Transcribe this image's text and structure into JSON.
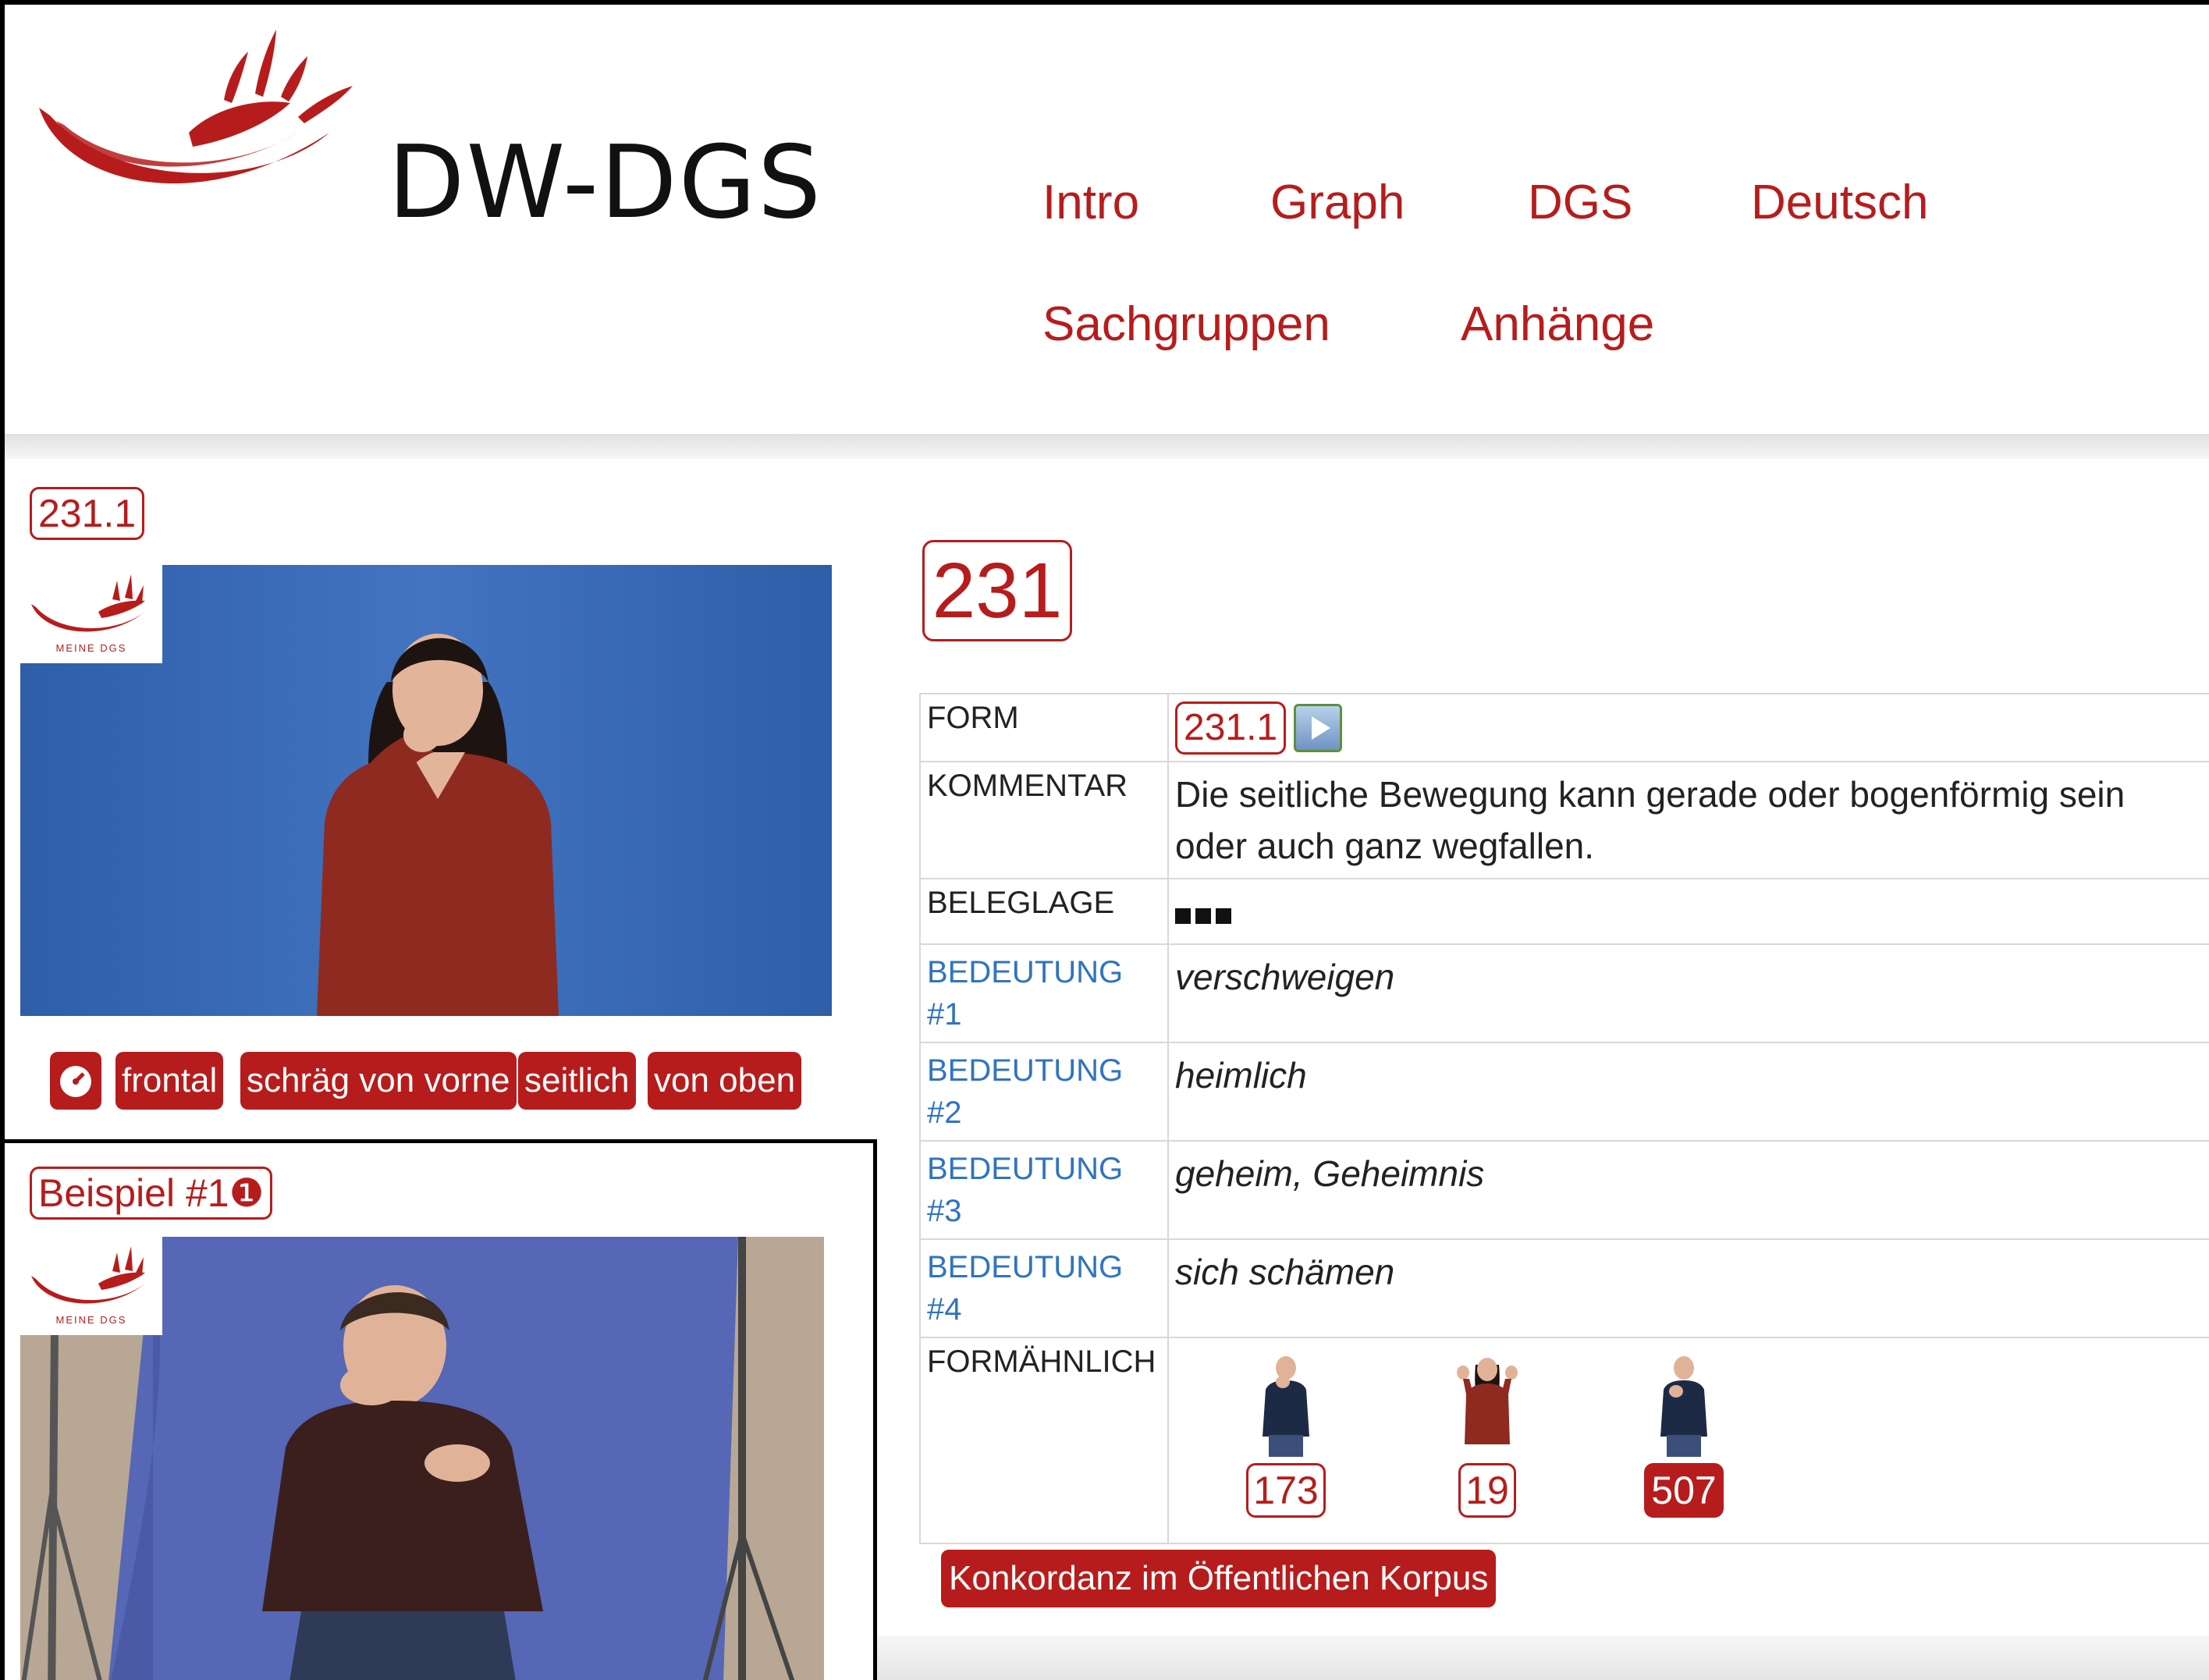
{
  "site": {
    "logo_text": "DW-DGS",
    "logo_caption": "MEINE DGS"
  },
  "nav": {
    "items": [
      {
        "label": "Intro"
      },
      {
        "label": "Graph"
      },
      {
        "label": "DGS"
      },
      {
        "label": "Deutsch"
      },
      {
        "label": "Sachgruppen"
      },
      {
        "label": "Anhänge"
      }
    ]
  },
  "form_video": {
    "tag": "231.1",
    "view_buttons": [
      "frontal",
      "schräg von vorne",
      "seitlich",
      "von oben"
    ],
    "speed_icon": "speedometer-icon"
  },
  "example_video": {
    "tag": "Beispiel #1",
    "badge": "❶"
  },
  "entry": {
    "number": "231",
    "rows": {
      "form": {
        "label": "FORM",
        "pill": "231.1",
        "icon": "play-icon"
      },
      "kommentar": {
        "label": "KOMMENTAR",
        "line1": "Die seitliche Bewegung kann gerade oder bogenförmig sein",
        "line2": "oder auch ganz wegfallen."
      },
      "beleglage": {
        "label": "BELEGLAGE",
        "level": 3
      },
      "meanings": [
        {
          "label1": "BEDEUTUNG",
          "label2": "#1",
          "value": "verschweigen"
        },
        {
          "label1": "BEDEUTUNG",
          "label2": "#2",
          "value": "heimlich"
        },
        {
          "label1": "BEDEUTUNG",
          "label2": "#3",
          "value": "geheim, Geheimnis"
        },
        {
          "label1": "BEDEUTUNG",
          "label2": "#4",
          "value": "sich schämen"
        }
      ],
      "formaehnlich": {
        "label": "FORMÄHNLICH",
        "items": [
          "173",
          "19",
          "507"
        ]
      }
    },
    "konkordanz": "Konkordanz im Öffentlichen Korpus"
  },
  "colors": {
    "accent": "#b71c1c",
    "link": "#2f74c0",
    "video_bg": "#3b68b0"
  }
}
